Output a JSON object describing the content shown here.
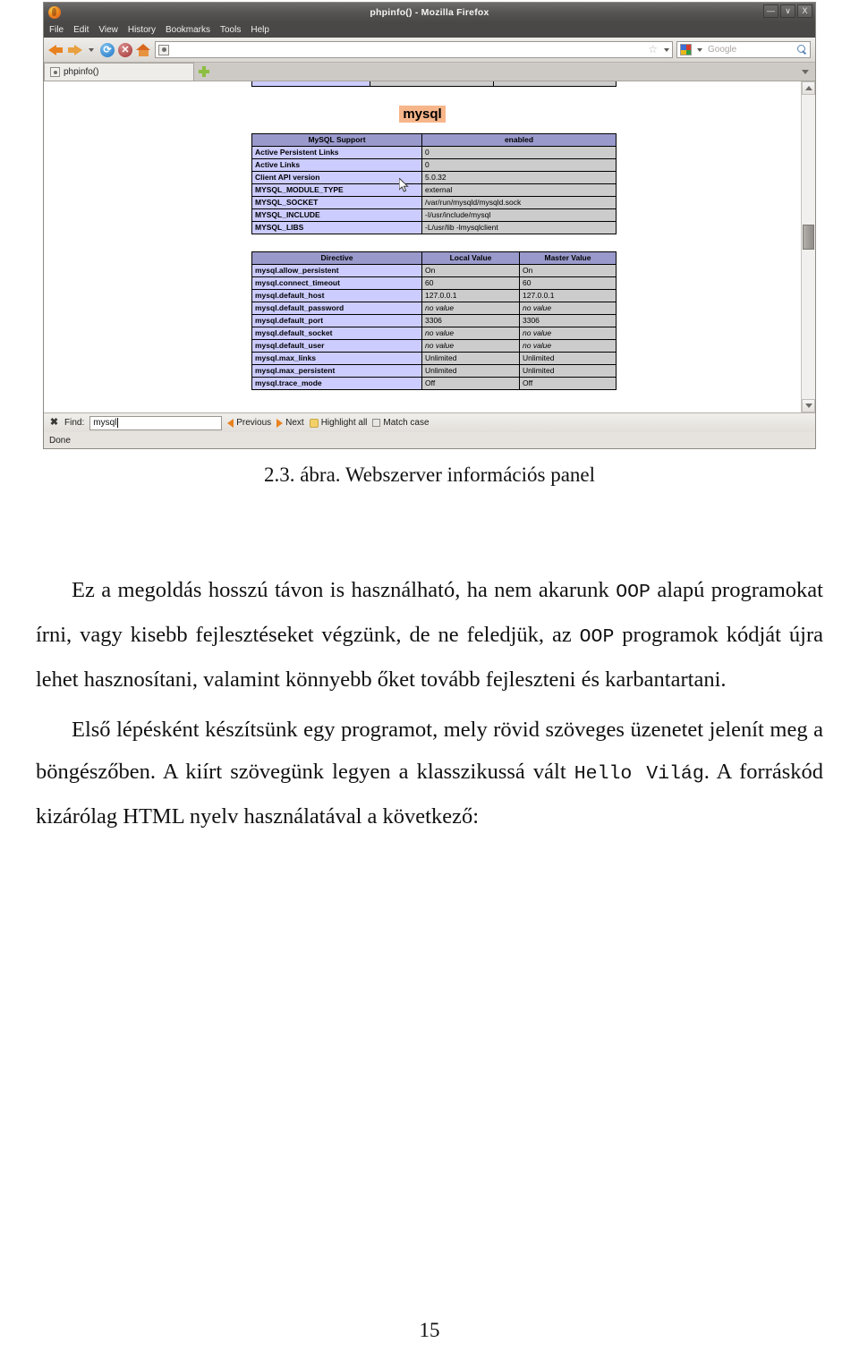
{
  "browser": {
    "window_title": "phpinfo() - Mozilla Firefox",
    "window_controls": {
      "minimize": "—",
      "maximize": "∨",
      "close": "X"
    },
    "menus": [
      "File",
      "Edit",
      "View",
      "History",
      "Bookmarks",
      "Tools",
      "Help"
    ],
    "toolbar": {
      "back_icon": "back-arrow-icon",
      "forward_icon": "forward-arrow-icon",
      "dropdown_icon": "chevron-down-icon",
      "reload_icon": "reload-icon",
      "stop_icon": "stop-icon",
      "home_icon": "home-icon",
      "url_value": "",
      "url_placeholder": "",
      "bookmark_icon": "star-icon",
      "search_placeholder": "Google",
      "search_value": "",
      "search_engine_icon": "google-icon",
      "search_go_icon": "magnifier-icon"
    },
    "tabs": [
      {
        "label": "phpinfo()",
        "favicon": "page-favicon-icon",
        "active": true
      }
    ],
    "new_tab_label": "+",
    "tab_list_icon": "chevron-down-icon"
  },
  "page": {
    "section_title": "mysql",
    "support_table": {
      "header": [
        "MySQL Support",
        "enabled"
      ],
      "rows": [
        [
          "Active Persistent Links",
          "0"
        ],
        [
          "Active Links",
          "0"
        ],
        [
          "Client API version",
          "5.0.32"
        ],
        [
          "MYSQL_MODULE_TYPE",
          "external"
        ],
        [
          "MYSQL_SOCKET",
          "/var/run/mysqld/mysqld.sock"
        ],
        [
          "MYSQL_INCLUDE",
          "-I/usr/include/mysql"
        ],
        [
          "MYSQL_LIBS",
          "-L/usr/lib -lmysqlclient"
        ]
      ]
    },
    "directive_table": {
      "headers": [
        "Directive",
        "Local Value",
        "Master Value"
      ],
      "rows": [
        [
          "mysql.allow_persistent",
          "On",
          "On"
        ],
        [
          "mysql.connect_timeout",
          "60",
          "60"
        ],
        [
          "mysql.default_host",
          "127.0.0.1",
          "127.0.0.1"
        ],
        [
          "mysql.default_password",
          "no value",
          "no value"
        ],
        [
          "mysql.default_port",
          "3306",
          "3306"
        ],
        [
          "mysql.default_socket",
          "no value",
          "no value"
        ],
        [
          "mysql.default_user",
          "no value",
          "no value"
        ],
        [
          "mysql.max_links",
          "Unlimited",
          "Unlimited"
        ],
        [
          "mysql.max_persistent",
          "Unlimited",
          "Unlimited"
        ],
        [
          "mysql.trace_mode",
          "Off",
          "Off"
        ]
      ]
    }
  },
  "findbar": {
    "close_icon": "close-icon",
    "label": "Find:",
    "value": "mysql",
    "previous": "Previous",
    "next": "Next",
    "highlight_all": "Highlight all",
    "match_case": "Match case"
  },
  "statusbar": {
    "text": "Done"
  },
  "document": {
    "figure_caption": "2.3. ábra. Webszerver információs panel",
    "paragraph_1": {
      "part1": "Ez a megoldás hosszú távon is használható, ha nem akarunk ",
      "mono1": "OOP",
      "part2": " alapú programokat írni, vagy kisebb fejlesztéseket végzünk, de ne feledjük, az ",
      "mono2": "OOP",
      "part3": " programok kódját újra lehet hasznosítani, valamint könnyebb őket tovább fejleszteni és karbantartani."
    },
    "paragraph_2": {
      "part1": "Első lépésként készítsünk egy programot, mely rövid szöveges üzenetet jelenít meg a böngészőben. A kiírt szövegünk legyen a klasszikussá vált ",
      "mono1": "Hello Világ",
      "part2": ". A forráskód kizárólag HTML nyelv használatával a következő:"
    },
    "page_number": "15"
  },
  "colors": {
    "table_header": "#9999cc",
    "table_key": "#ccccff",
    "table_value": "#cccccc",
    "section_highlight": "#f7b68a",
    "accent_orange": "#e8821f"
  }
}
